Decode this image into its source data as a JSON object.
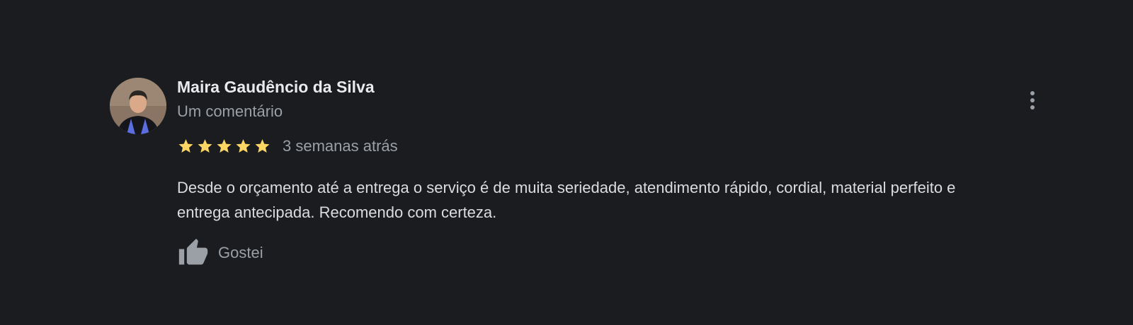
{
  "review": {
    "reviewer_name": "Maira Gaudêncio da Silva",
    "reviewer_meta": "Um comentário",
    "rating": 5,
    "rating_max": 5,
    "date": "3 semanas atrás",
    "text": "Desde o orçamento até a entrega o serviço é de muita seriedade, atendimento rápido, cordial, material perfeito e entrega antecipada. Recomendo com certeza.",
    "like_label": "Gostei"
  },
  "icons": {
    "star": "star-icon",
    "like": "thumbs-up-icon",
    "more": "more-vert-icon"
  },
  "colors": {
    "background": "#1b1c20",
    "star": "#fdd663",
    "muted_text": "#9aa0a6"
  }
}
